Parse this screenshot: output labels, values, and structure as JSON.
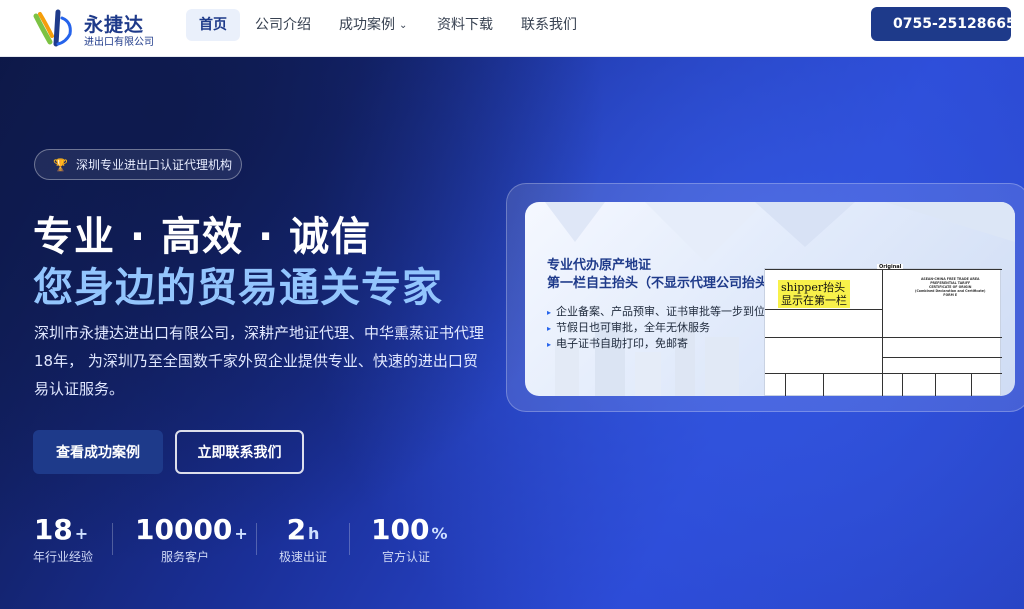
{
  "header": {
    "brand_name": "永捷达",
    "brand_sub": "进出口有限公司",
    "nav": [
      {
        "label": "首页",
        "active": true
      },
      {
        "label": "公司介绍",
        "active": false
      },
      {
        "label": "成功案例",
        "active": false,
        "dropdown": true
      },
      {
        "label": "资料下载",
        "active": false
      },
      {
        "label": "联系我们",
        "active": false
      }
    ],
    "phone": "0755-25128665"
  },
  "hero": {
    "badge": "深圳专业进出口认证代理机构",
    "title_line1": "专业 · 高效 · 诚信",
    "title_line2": "您身边的贸易通关专家",
    "description": "深圳市永捷达进出口有限公司，深耕产地证代理、中华熏蒸证书代理18年， 为深圳乃至全国数千家外贸企业提供专业、快速的进出口贸易认证服务。",
    "cta_primary": "查看成功案例",
    "cta_secondary": "立即联系我们",
    "stats": [
      {
        "value": "18",
        "suffix": "+",
        "label": "年行业经验"
      },
      {
        "value": "10000",
        "suffix": "+",
        "label": "服务客户"
      },
      {
        "value": "2",
        "suffix": "h",
        "label": "极速出证"
      },
      {
        "value": "100",
        "suffix": "%",
        "label": "官方认证"
      }
    ]
  },
  "card": {
    "heading1": "专业代办原产地证",
    "heading2": "第一栏自主抬头（不显示代理公司抬头）",
    "features": [
      "企业备案、产品预审、证书审批等一步到位",
      "节假日也可审批，全年无休服务",
      "电子证书自助打印，免邮寄"
    ],
    "doc_label": "Original",
    "doc_highlight1": "shipper抬头",
    "doc_highlight2": "显示在第一栏",
    "doc_title_lines": [
      "ASEAN-CHINA FREE TRADE AREA",
      "PREFERENTIAL TARIFF",
      "CERTIFICATE OF ORIGIN",
      "(Combined Declaration and Certificate)",
      "FORM E"
    ]
  },
  "colors": {
    "brand": "#1e3a8a",
    "accent_light": "#93c5fd",
    "hero_start": "#0c1640",
    "hero_end": "#2b49d6"
  }
}
